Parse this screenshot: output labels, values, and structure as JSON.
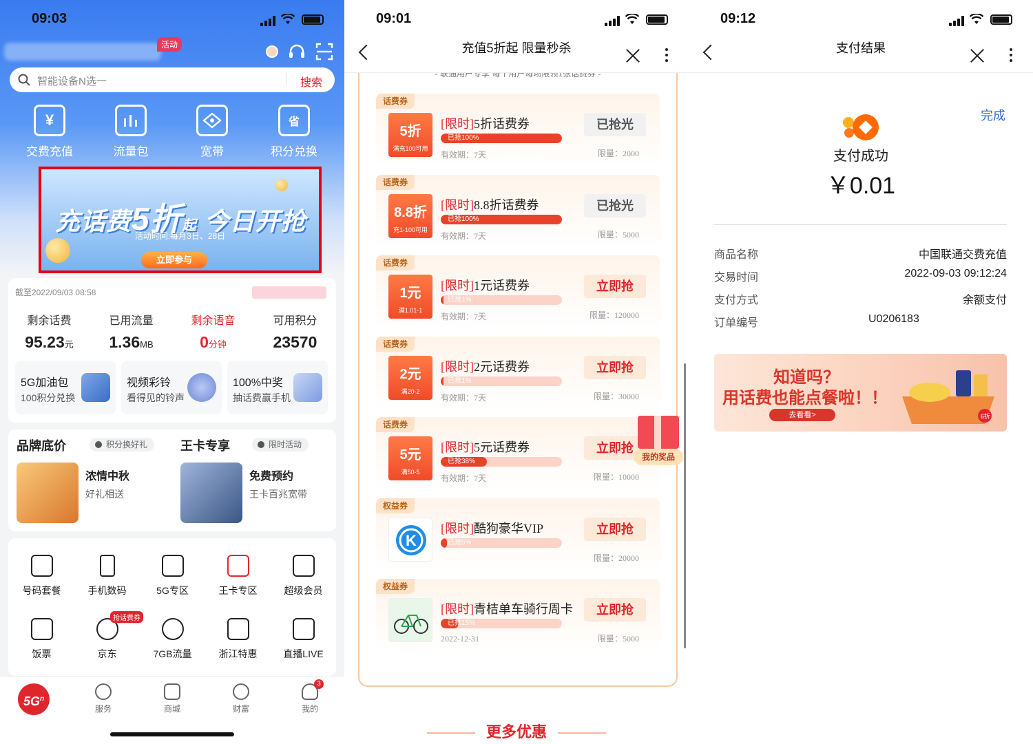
{
  "panel1": {
    "status": {
      "time": "09:03"
    },
    "activity_badge": "活动",
    "search": {
      "placeholder": "智能设备N选一",
      "button": "搜索"
    },
    "quick_nav": [
      {
        "label": "交费充值",
        "icon": "yuan-icon"
      },
      {
        "label": "流量包",
        "icon": "bar-chart-icon"
      },
      {
        "label": "宽带",
        "icon": "router-icon"
      },
      {
        "label": "积分兑换",
        "icon": "savings-icon"
      }
    ],
    "banner": {
      "title_a": "充话费",
      "title_b": "5折",
      "title_c": "起",
      "title_d": "今日开抢",
      "subtitle": "活动时间:每月3日、28日",
      "button": "立即参与"
    },
    "account": {
      "as_of": "截至2022/09/03 08:58",
      "stats": [
        {
          "label": "剩余话费",
          "value": "95.23",
          "unit": "元",
          "highlight": false
        },
        {
          "label": "已用流量",
          "value": "1.36",
          "unit": "MB",
          "highlight": false
        },
        {
          "label": "剩余语音",
          "value": "0",
          "unit": "分钟",
          "highlight": true
        },
        {
          "label": "可用积分",
          "value": "23570",
          "unit": "",
          "highlight": false
        }
      ],
      "promos": [
        {
          "title": "5G加油包",
          "sub": "100积分兑换"
        },
        {
          "title": "视频彩铃",
          "sub": "看得见的铃声"
        },
        {
          "title": "100%中奖",
          "sub": "抽话费赢手机"
        }
      ]
    },
    "brand": {
      "left_heading": "品牌底价",
      "left_tag": "积分换好礼",
      "right_heading": "王卡专享",
      "right_tag": "限时活动",
      "left_item": {
        "title": "浓情中秋",
        "sub": "好礼相送"
      },
      "right_item": {
        "title": "免费预约",
        "sub": "王卡百兆宽带"
      }
    },
    "services": [
      {
        "label": "号码套餐",
        "icon": "sim-card-icon"
      },
      {
        "label": "手机数码",
        "icon": "phone-5g-icon"
      },
      {
        "label": "5G专区",
        "icon": "5g-icon"
      },
      {
        "label": "王卡专区",
        "icon": "crown-card-icon"
      },
      {
        "label": "超级会员",
        "icon": "vip-crown-icon"
      },
      {
        "label": "饭票",
        "icon": "utensils-icon"
      },
      {
        "label": "京东",
        "icon": "jd-mascot-icon",
        "hot": "抢话费券"
      },
      {
        "label": "7GB流量",
        "icon": "heart-data-icon"
      },
      {
        "label": "浙江特惠",
        "icon": "pagoda-icon"
      },
      {
        "label": "直播LIVE",
        "icon": "live-tv-icon"
      }
    ],
    "tabbar": {
      "home": "5G",
      "home_sup": "n",
      "items": [
        {
          "label": "服务",
          "icon": "apps-icon"
        },
        {
          "label": "商城",
          "icon": "shopping-bag-icon"
        },
        {
          "label": "财富",
          "icon": "coin-icon"
        },
        {
          "label": "我的",
          "icon": "person-icon",
          "badge": "3"
        }
      ]
    }
  },
  "panel2": {
    "status": {
      "time": "09:01"
    },
    "title": "充值5折起 限量秒杀",
    "note": "- 联通用户专享 每个用户每场限领1张话费券 -",
    "coupons": [
      {
        "type": "话费券",
        "face": "5折",
        "face_sub": "满充100可用",
        "prefix": "[限时]",
        "name": "5折话费券",
        "progress": 1.0,
        "progress_text": "已抢100%",
        "validity": "有效期：7天",
        "button": "已抢光",
        "available": false,
        "limit": "限量：2000"
      },
      {
        "type": "话费券",
        "face": "8.8折",
        "face_sub": "充1-100可用",
        "prefix": "[限时]",
        "name": "8.8折话费券",
        "progress": 1.0,
        "progress_text": "已抢100%",
        "validity": "有效期：7天",
        "button": "已抢光",
        "available": false,
        "limit": "限量：5000"
      },
      {
        "type": "话费券",
        "face": "1元",
        "face_sub": "满1.01-1",
        "prefix": "[限时]",
        "name": "1元话费券",
        "progress": 0.01,
        "progress_text": "已抢1%",
        "validity": "有效期：7天",
        "button": "立即抢",
        "available": true,
        "limit": "限量：120000"
      },
      {
        "type": "话费券",
        "face": "2元",
        "face_sub": "满20-2",
        "prefix": "[限时]",
        "name": "2元话费券",
        "progress": 0.01,
        "progress_text": "已抢1%",
        "validity": "有效期：7天",
        "button": "立即抢",
        "available": true,
        "limit": "限量：30000"
      },
      {
        "type": "话费券",
        "face": "5元",
        "face_sub": "满50-5",
        "prefix": "[限时]",
        "name": "5元话费券",
        "progress": 0.38,
        "progress_text": "已抢38%",
        "validity": "有效期：7天",
        "button": "立即抢",
        "available": true,
        "limit": "限量：10000"
      },
      {
        "type": "权益券",
        "face": "K",
        "face_sub": "",
        "prefix": "[限时]",
        "name": "酷狗豪华VIP",
        "progress": 0.05,
        "progress_text": "已抢5%",
        "validity": "",
        "button": "立即抢",
        "available": true,
        "limit": "限量：20000",
        "image": "kugou-logo-icon"
      },
      {
        "type": "权益券",
        "face": "",
        "face_sub": "",
        "prefix": "[限时]",
        "name": "青桔单车骑行周卡",
        "progress": 0.15,
        "progress_text": "已抢15%",
        "validity": "2022-12-31",
        "button": "立即抢",
        "available": true,
        "limit": "限量：5000",
        "image": "bicycle-icon"
      }
    ],
    "gift": "我的奖品",
    "more": "更多优惠"
  },
  "panel3": {
    "status": {
      "time": "09:12"
    },
    "title": "支付结果",
    "done": "完成",
    "result": "支付成功",
    "amount": "￥0.01",
    "details": [
      {
        "key": "商品名称",
        "value": "中国联通交费充值"
      },
      {
        "key": "交易时间",
        "value": "2022-09-03 09:12:24"
      },
      {
        "key": "支付方式",
        "value": "余额支付"
      },
      {
        "key": "订单编号",
        "value": "U0206183"
      }
    ],
    "ad": {
      "line1": "知道吗？",
      "line2": "用话费也能点餐啦！！",
      "button": "去看看>",
      "badge": "6折"
    }
  }
}
